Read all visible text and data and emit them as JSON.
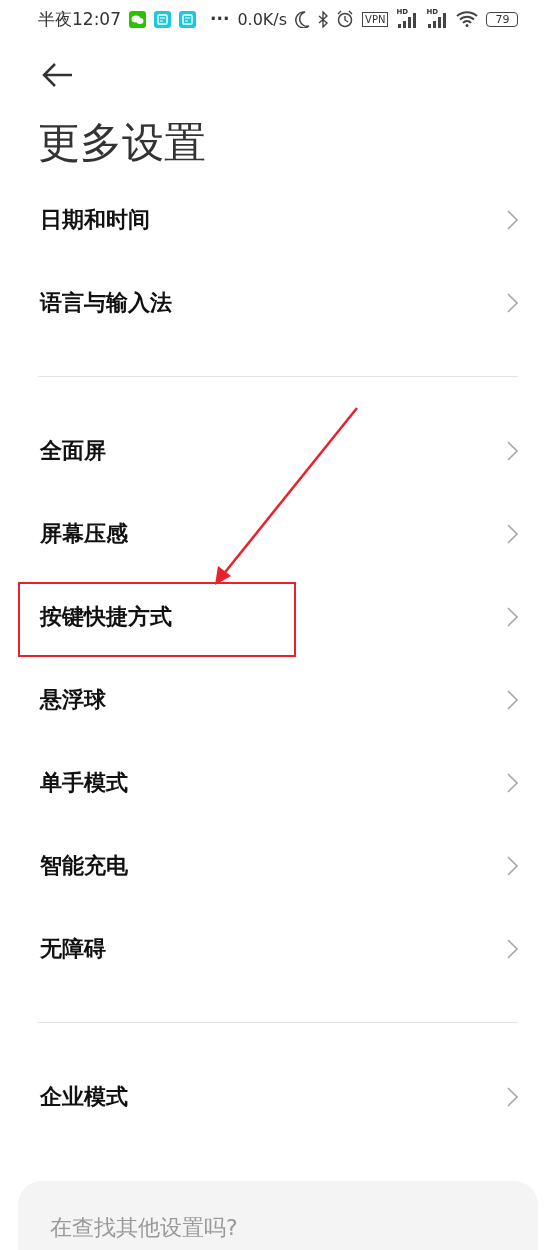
{
  "status_bar": {
    "time": "半夜12:07",
    "more": "···",
    "network_speed": "0.0K/s",
    "vpn": "VPN",
    "signal_labels": [
      "HD",
      "HD"
    ],
    "battery": "79"
  },
  "title": "更多设置",
  "groups": [
    {
      "items": [
        {
          "label": "日期和时间",
          "highlighted": false
        },
        {
          "label": "语言与输入法",
          "highlighted": false
        }
      ]
    },
    {
      "items": [
        {
          "label": "全面屏",
          "highlighted": false
        },
        {
          "label": "屏幕压感",
          "highlighted": false
        },
        {
          "label": "按键快捷方式",
          "highlighted": true
        },
        {
          "label": "悬浮球",
          "highlighted": false
        },
        {
          "label": "单手模式",
          "highlighted": false
        },
        {
          "label": "智能充电",
          "highlighted": false
        },
        {
          "label": "无障碍",
          "highlighted": false
        }
      ]
    },
    {
      "items": [
        {
          "label": "企业模式",
          "highlighted": false
        }
      ]
    }
  ],
  "search_card": {
    "text": "在查找其他设置吗?"
  }
}
